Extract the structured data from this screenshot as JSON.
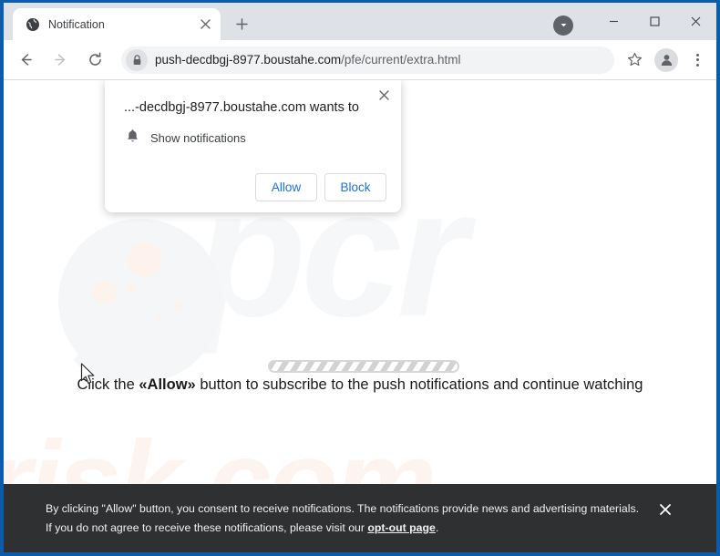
{
  "browser": {
    "tab": {
      "title": "Notification",
      "favicon_icon": "globe-icon",
      "close_icon": "close-icon"
    },
    "new_tab_icon": "plus-icon",
    "window_controls": {
      "caret_icon": "caret-down-icon",
      "minimize_icon": "minimize-icon",
      "maximize_icon": "maximize-icon",
      "close_icon": "close-icon"
    },
    "toolbar": {
      "back_icon": "back-arrow-icon",
      "forward_icon": "forward-arrow-icon",
      "reload_icon": "reload-icon",
      "lock_icon": "lock-icon",
      "url_domain": "push-decdbgj-8977.boustahe.com",
      "url_path": "/pfe/current/extra.html",
      "star_icon": "star-icon",
      "avatar_icon": "profile-avatar-icon",
      "menu_icon": "three-dot-menu-icon"
    }
  },
  "permission_dialog": {
    "title": "...-decdbgj-8977.boustahe.com wants to",
    "bell_icon": "bell-icon",
    "permission_label": "Show notifications",
    "allow_label": "Allow",
    "block_label": "Block",
    "close_icon": "close-icon"
  },
  "page": {
    "message_prefix": "Click the ",
    "message_emphasis": "«Allow»",
    "message_suffix": " button to subscribe to the push notifications and continue watching",
    "watermark_top": "pcr",
    "watermark_bottom": "risk.com",
    "cursor_icon": "mouse-pointer-icon"
  },
  "consent_banner": {
    "text_before_link": "By clicking \"Allow\" button, you consent to receive notifications. The notifications provide news and advertising materials. If you do not agree to receive these notifications, please visit our ",
    "link_label": "opt-out page",
    "text_after_link": ".",
    "close_icon": "close-icon"
  },
  "colors": {
    "window_frame": "#0b5cab",
    "tabstrip": "#dee1e6",
    "accent_blue": "#1a73e8",
    "banner_bg": "#2f3031"
  }
}
